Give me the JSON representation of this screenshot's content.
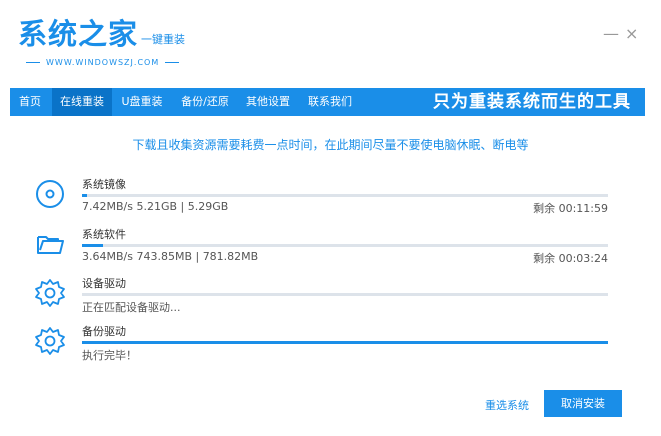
{
  "header": {
    "logo_main": "系统之家",
    "logo_sub": "一键重装",
    "logo_url": "WWW.WINDOWSZJ.COM",
    "minimize": "—",
    "close": "×"
  },
  "nav": {
    "tabs": [
      {
        "label": "首页"
      },
      {
        "label": "在线重装",
        "active": true
      },
      {
        "label": "U盘重装"
      },
      {
        "label": "备份/还原"
      },
      {
        "label": "其他设置"
      },
      {
        "label": "联系我们"
      }
    ],
    "slogan": "只为重装系统而生的工具"
  },
  "notice": "下载且收集资源需要耗费一点时间，在此期间尽量不要使电脑休眠、断电等",
  "tasks": [
    {
      "icon": "disc-icon",
      "title": "系统镜像",
      "progress": 0.01,
      "status": "7.42MB/s 5.21GB | 5.29GB",
      "remaining": "剩余 00:11:59"
    },
    {
      "icon": "folder-icon",
      "title": "系统软件",
      "progress": 0.04,
      "status": "3.64MB/s 743.85MB | 781.82MB",
      "remaining": "剩余 00:03:24"
    },
    {
      "icon": "gear-icon",
      "title": "设备驱动",
      "progress": 0,
      "status": "正在匹配设备驱动...",
      "remaining": ""
    },
    {
      "icon": "gear-icon",
      "title": "备份驱动",
      "progress": 1,
      "status": "执行完毕！",
      "remaining": ""
    }
  ],
  "buttons": {
    "reselect": "重选系统",
    "cancel": "取消安装"
  },
  "colors": {
    "accent": "#1a8ee8",
    "nav_active": "#0a73c8"
  }
}
